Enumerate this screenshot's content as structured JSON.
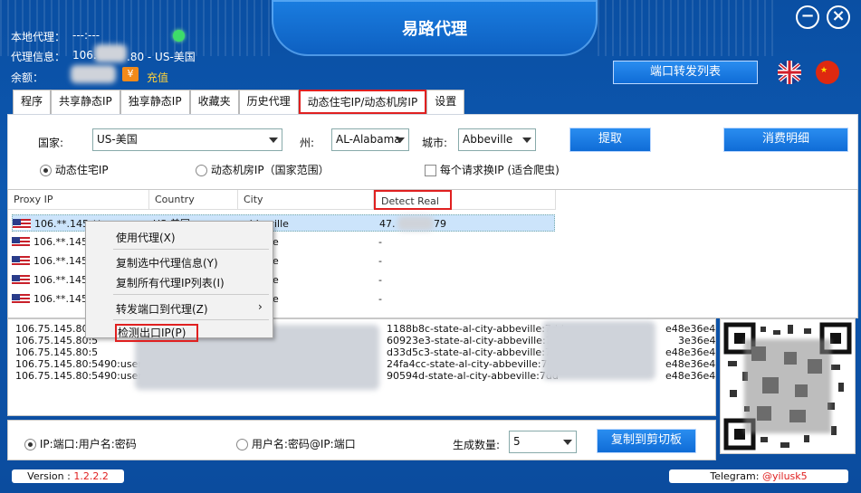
{
  "window": {
    "title": "易路代理",
    "minimize_icon": "minimize-icon",
    "close_icon": "close-icon"
  },
  "info": {
    "local_proxy_label": "本地代理：",
    "local_proxy_value": "---:---",
    "proxy_info_label": "代理信息：",
    "proxy_info_prefix": "106.",
    "proxy_info_suffix": ".80 - US-美国",
    "balance_label": "余额：",
    "recharge": "充值"
  },
  "port_forward_button": "端口转发列表",
  "tabs": [
    "程序",
    "共享静态IP",
    "独享静态IP",
    "收藏夹",
    "历史代理",
    "动态住宅IP/动态机房IP",
    "设置"
  ],
  "filters": {
    "country_label": "国家:",
    "country_value": "US-美国",
    "state_label": "州:",
    "state_value": "AL-Alabama",
    "city_label": "城市:",
    "city_value": "Abbeville",
    "extract_button": "提取",
    "consume_button": "消费明细",
    "radio_residential": "动态住宅IP",
    "radio_datacenter": "动态机房IP（国家范围）",
    "rotate_each_request": "每个请求换IP (适合爬虫)"
  },
  "grid": {
    "headers": [
      "Proxy IP",
      "Country",
      "City",
      "Detect Real IP"
    ],
    "rows": [
      {
        "ip": "106.**.145.**",
        "country": "US-美国",
        "city": "abbeville",
        "real": "47.",
        "real_tail": "79"
      },
      {
        "ip": "106.**.145.**",
        "country": "",
        "city": "le",
        "real": "-"
      },
      {
        "ip": "106.**.145.**",
        "country": "",
        "city": "le",
        "real": "-"
      },
      {
        "ip": "106.**.145.**",
        "country": "",
        "city": "le",
        "real": "-"
      },
      {
        "ip": "106.**.145.**",
        "country": "",
        "city": "le",
        "real": "-"
      }
    ]
  },
  "context_menu": {
    "items": [
      "使用代理(X)",
      "复制选中代理信息(Y)",
      "复制所有代理IP列表(I)",
      "转发端口到代理(Z)",
      "检测出口IP(P)"
    ]
  },
  "output_lines": [
    {
      "left": "106.75.145.80:5",
      "mid": "1188b8c-state-al-city-abbeville:7dd",
      "right": "e48e36e4"
    },
    {
      "left": "106.75.145.80:5",
      "mid": "60923e3-state-al-city-abbeville:7dd",
      "right": "3e36e4"
    },
    {
      "left": "106.75.145.80:5",
      "mid": "d33d5c3-state-al-city-abbeville:7dd",
      "right": "e48e36e4"
    },
    {
      "left": "106.75.145.80:5490:user-96",
      "mid": "24fa4cc-state-al-city-abbeville:7dd",
      "right": "e48e36e4"
    },
    {
      "left": "106.75.145.80:5490:user-",
      "mid": "90594d-state-al-city-abbeville:7dd",
      "right": "e48e36e4"
    }
  ],
  "format": {
    "opt1": "IP:端口:用户名:密码",
    "opt2": "用户名:密码@IP:端口",
    "count_label": "生成数量:",
    "count_value": "5",
    "copy_button": "复制到剪切板"
  },
  "footer": {
    "version_label": "Version : ",
    "version_value": "1.2.2.2",
    "telegram_label": "Telegram: ",
    "telegram_value": "@yilusk5"
  },
  "colors": {
    "bg": "#0b4c9e",
    "accent": "#0f6cd6",
    "highlight": "#e02020"
  }
}
